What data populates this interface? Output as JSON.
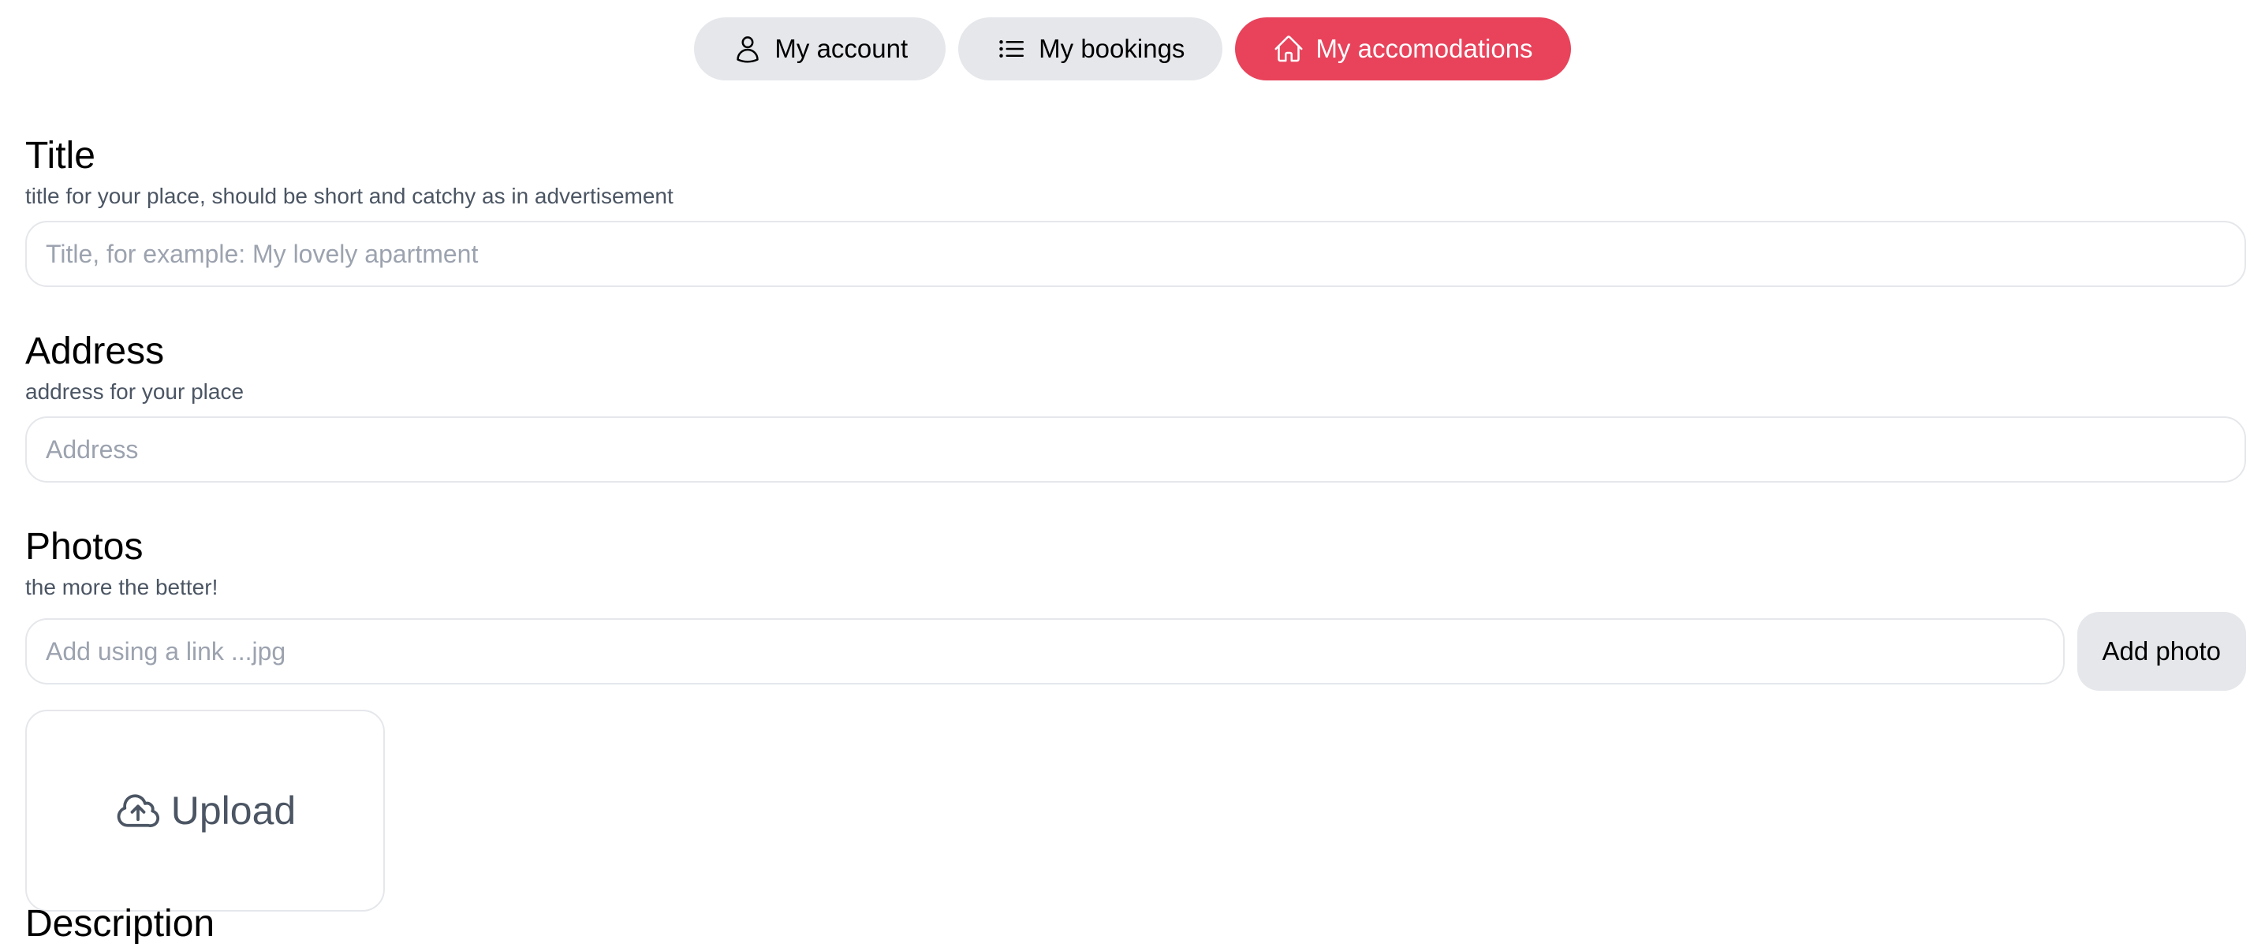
{
  "nav": {
    "items": [
      {
        "label": "My account",
        "icon": "user-icon",
        "active": false
      },
      {
        "label": "My bookings",
        "icon": "list-icon",
        "active": false
      },
      {
        "label": "My accomodations",
        "icon": "home-icon",
        "active": true
      }
    ],
    "active_color": "#e8435b",
    "inactive_color": "#e5e7eb"
  },
  "form": {
    "title": {
      "heading": "Title",
      "description": "title for your place, should be short and catchy as in advertisement",
      "placeholder": "Title, for example: My lovely apartment",
      "value": ""
    },
    "address": {
      "heading": "Address",
      "description": "address for your place",
      "placeholder": "Address",
      "value": ""
    },
    "photos": {
      "heading": "Photos",
      "description": "the more the better!",
      "link_placeholder": "Add using a link ...jpg",
      "link_value": "",
      "add_button_label": "Add photo",
      "upload_label": "Upload",
      "upload_icon": "cloud-upload-icon"
    },
    "description": {
      "heading": "Description"
    }
  }
}
